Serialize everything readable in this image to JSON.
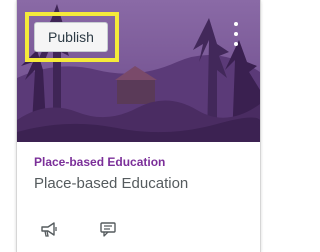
{
  "card": {
    "publish_label": "Publish",
    "course_title": "Place-based Education",
    "course_subtitle": "Place-based Education",
    "accent_color": "#7b2f99",
    "highlight_color": "#f5ea3a"
  },
  "icons": {
    "more_options": "kebab-menu-icon",
    "announcements": "megaphone-icon",
    "discussions": "discussion-icon"
  }
}
